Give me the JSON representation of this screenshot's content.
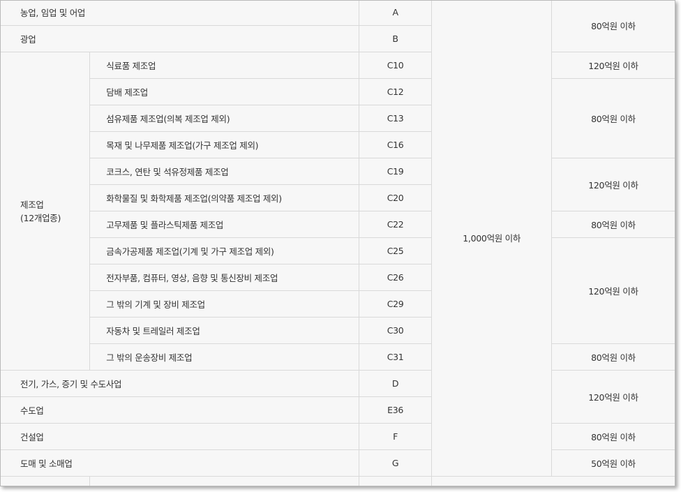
{
  "table": {
    "rows": [
      {
        "industry": "농업, 임업 및 어업",
        "code": "A"
      },
      {
        "industry": "광업",
        "code": "B"
      },
      {
        "subindustry": "식료품 제조업",
        "code": "C10"
      },
      {
        "subindustry": "담배 제조업",
        "code": "C12"
      },
      {
        "subindustry": "섬유제품 제조업(의복 제조업 제외)",
        "code": "C13"
      },
      {
        "subindustry": "목재 및 나무제품 제조업(가구 제조업 제외)",
        "code": "C16"
      },
      {
        "subindustry": "코크스, 연탄 및 석유정제품 제조업",
        "code": "C19"
      },
      {
        "subindustry": "화학물질 및 화학제품 제조업(의약품 제조업 제외)",
        "code": "C20"
      },
      {
        "subindustry": "고무제품 및 플라스틱제품 제조업",
        "code": "C22"
      },
      {
        "subindustry": "금속가공제품 제조업(기계 및 가구 제조업 제외)",
        "code": "C25"
      },
      {
        "subindustry": "전자부품, 컴퓨터, 영상, 음향 및 통신장비 제조업",
        "code": "C26"
      },
      {
        "subindustry": "그 밖의 기계 및 장비 제조업",
        "code": "C29"
      },
      {
        "subindustry": "자동차 및 트레일러 제조업",
        "code": "C30"
      },
      {
        "subindustry": "그 밖의 운송장비 제조업",
        "code": "C31"
      },
      {
        "industry": "전기, 가스, 증기 및 수도사업",
        "code": "D"
      },
      {
        "industry": "수도업",
        "code": "E36"
      },
      {
        "industry": "건설업",
        "code": "F"
      },
      {
        "industry": "도매 및 소매업",
        "code": "G"
      }
    ],
    "manufacturing": {
      "line1": "제조업",
      "line2": "(12개업종)"
    },
    "total_assets": "1,000억원 이하",
    "sales": [
      "80억원 이하",
      "120억원 이하",
      "80억원 이하",
      "120억원 이하",
      "80억원 이하",
      "120억원 이하",
      "80억원 이하",
      "120억원 이하",
      "80억원 이하",
      "50억원 이하"
    ]
  }
}
